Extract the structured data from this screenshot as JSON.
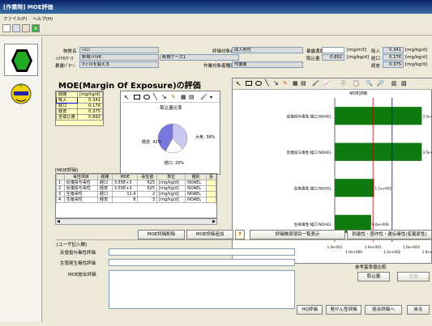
{
  "window": {
    "title": "[作業時] MOE評価"
  },
  "menu": [
    "ファイル(F)",
    "ヘルプ(H)"
  ],
  "header": {
    "substance_label": "物質名",
    "substance_value": "ﾄﾙｴﾝ",
    "scenario_label": "ｼﾅﾘｵ/ｹｰｽ",
    "scenario_value": "新規ｼﾅﾘｵ6",
    "case_value": "新規ケース1",
    "exposure_pattern_label": "暴露ﾊﾟﾀｰﾝ",
    "exposure_pattern_value": "3ヶ月を超える",
    "evaluator_label": "評価対象者",
    "evaluator_value": "成人男性",
    "worker_type_label": "作業対象者種別",
    "worker_type_value": "作業者",
    "exposure_conc_label": "暴露濃度",
    "exposure_conc_unit": "[mg/m3]",
    "intake_label": "取込量",
    "intake_value": "0.892",
    "intake_unit": "[mg/kg/d]",
    "inhal_label": "吸入",
    "inhal_value": "0.341",
    "inhal_unit": "[mg/kg/d]",
    "oral_label": "経口",
    "oral_value": "0.176",
    "oral_unit": "[mg/kg/d]",
    "dermal_label": "経皮",
    "dermal_value": "0.375",
    "dermal_unit": "[mg/kg/d]"
  },
  "moe_title": "MOE(Margin Of Exposure)の評価",
  "exposure_table": {
    "headers": [
      "経路",
      "[mg/kg/d]"
    ],
    "rows": [
      [
        "吸入",
        "0.341"
      ],
      [
        "経口",
        "0.176"
      ],
      [
        "経皮",
        "0.375"
      ],
      [
        "全取込量",
        "0.892"
      ]
    ]
  },
  "pie": {
    "title": "取込量比率",
    "slices": [
      {
        "label": "大気",
        "value": 38,
        "text": "大気: 38%",
        "color": "#c8c8f0"
      },
      {
        "label": "経口",
        "value": 20,
        "text": "経口: 20%",
        "color": "#ffffff"
      },
      {
        "label": "経皮",
        "value": 42,
        "text": "経皮: 42%",
        "color": "#7777dd"
      }
    ]
  },
  "moe_grid": {
    "section_label": "[MOE評価]",
    "headers": [
      "",
      "毒性項目",
      "経路",
      "MOE",
      "毒性値",
      "単位",
      "種別",
      "投"
    ],
    "rows": [
      [
        "1",
        "反復投与毒性",
        "経口",
        "3.55E+3",
        "625",
        "[mg/kg/d]",
        "NOAEL",
        ""
      ],
      [
        "2",
        "反復投与毒性",
        "経皮",
        "3.55E+3",
        "625",
        "[mg/kg/d]",
        "NOAEL",
        ""
      ],
      [
        "3",
        "生殖毒性",
        "経口",
        "11.4",
        "2",
        "[mg/kg/d]",
        "NOAEL",
        ""
      ],
      [
        "4",
        "生殖毒性",
        "経皮",
        "8",
        "3",
        "[mg/kg/d]",
        "NOAEL",
        ""
      ]
    ]
  },
  "chart_data": {
    "type": "bar",
    "orientation": "horizontal",
    "title": "MOE評価",
    "categories": [
      "反復投与毒性:経口:NOAEL",
      "反復投与毒性:経口:NOAEL",
      "生殖毒性:経口:NOAEL",
      "生殖毒性:経口:NOAEL"
    ],
    "values": [
      3550,
      3550,
      11.4,
      8
    ],
    "data_labels": [
      "3.5e+003",
      "3.5e+003",
      "1.1e+001",
      "8.0e+000"
    ],
    "x_scale": "log",
    "xlim": [
      0.1,
      10000
    ],
    "x_ticks": [
      "1.0e-001",
      "1.0e+000",
      "1.0e+001",
      "1.0e+002",
      "1.0e+003",
      "1.0e+004"
    ],
    "reference_lines": [
      {
        "value": 10,
        "color": "#cc0000"
      },
      {
        "value": 100,
        "color": "#0000cc"
      }
    ],
    "bar_color": "#0f7a0f"
  },
  "buttons": {
    "moe_delete": "MOE評価削除",
    "moe_add": "MOE評価追加",
    "help": "?",
    "eval_item_list": "評価推奨項目一覧表示",
    "toxicity_note": "刺激性・感作性・遺伝毒性(変異原性)",
    "intake": "取込量",
    "add_small": "追加",
    "hq_eval": "HQ評価",
    "carcinogen_eval": "発がん性評価",
    "overall_eval": "総合評価へ",
    "back": "戻る"
  },
  "user_entry": {
    "section_label": "[ユーザ記入欄]",
    "repeat_label": "反復投与毒性評価",
    "repro_label": "生殖発生毒性評価",
    "moe_overall_label": "MOE総合評価"
  },
  "reference": {
    "label": "参考基準値比較"
  }
}
